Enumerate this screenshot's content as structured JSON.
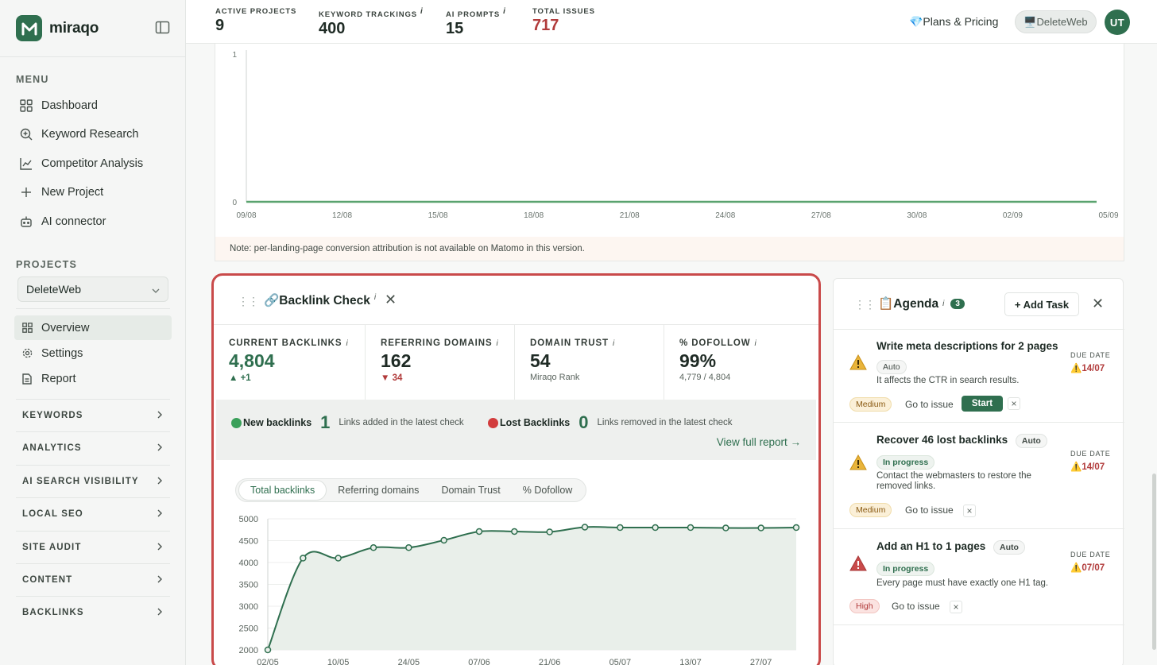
{
  "app": {
    "name": "miraqo"
  },
  "sidebar": {
    "menu_label": "MENU",
    "menu_items": [
      {
        "label": "Dashboard",
        "icon": "grid-icon"
      },
      {
        "label": "Keyword Research",
        "icon": "search-icon"
      },
      {
        "label": "Competitor Analysis",
        "icon": "chart-line-icon"
      },
      {
        "label": "New Project",
        "icon": "plus-icon"
      },
      {
        "label": "AI connector",
        "icon": "robot-icon"
      }
    ],
    "projects_label": "PROJECTS",
    "project_selected": "DeleteWeb",
    "project_items": [
      {
        "label": "Overview",
        "icon": "grid-icon",
        "active": true
      },
      {
        "label": "Settings",
        "icon": "gear-icon"
      },
      {
        "label": "Report",
        "icon": "document-icon"
      }
    ],
    "groups": [
      "KEYWORDS",
      "ANALYTICS",
      "AI SEARCH VISIBILITY",
      "LOCAL SEO",
      "SITE AUDIT",
      "CONTENT",
      "BACKLINKS"
    ]
  },
  "topbar": {
    "stats": [
      {
        "label": "ACTIVE PROJECTS",
        "value": "9",
        "info": ""
      },
      {
        "label": "KEYWORD TRACKINGS",
        "value": "400",
        "info": "i"
      },
      {
        "label": "AI PROMPTS",
        "value": "15",
        "info": "i"
      },
      {
        "label": "TOTAL ISSUES",
        "value": "717",
        "info": ""
      }
    ],
    "plans_label": "💎Plans & Pricing",
    "site_label": "🖥️DeleteWeb",
    "avatar_initials": "UT"
  },
  "conversion_chart": {
    "y_ticks": [
      "1",
      "0"
    ],
    "x_ticks": [
      "09/08",
      "12/08",
      "15/08",
      "18/08",
      "21/08",
      "24/08",
      "27/08",
      "30/08",
      "02/09",
      "05/09"
    ],
    "note": "Note: per-landing-page conversion attribution is not available on Matomo in this version."
  },
  "backlink_check": {
    "title": "🔗Backlink Check",
    "info": "i",
    "kpis": [
      {
        "label": "CURRENT BACKLINKS",
        "value": "4,804",
        "delta": "▲ +1",
        "delta_dir": "up",
        "sub": ""
      },
      {
        "label": "REFERRING DOMAINS",
        "value": "162",
        "delta": "▼ 34",
        "delta_dir": "down",
        "sub": ""
      },
      {
        "label": "DOMAIN TRUST",
        "value": "54",
        "delta": "",
        "sub": "Miraqo Rank"
      },
      {
        "label": "% DOFOLLOW",
        "value": "99%",
        "delta": "",
        "sub": "4,779 / 4,804"
      }
    ],
    "new_backlinks": {
      "label": "New backlinks",
      "count": "1",
      "desc": "Links added in the latest check",
      "color": "#3aa05a"
    },
    "lost_backlinks": {
      "label": "Lost Backlinks",
      "count": "0",
      "desc": "Links removed in the latest check",
      "color": "#d23c3c"
    },
    "view_full": "View full report →",
    "tabs": [
      {
        "label": "Total backlinks",
        "active": true
      },
      {
        "label": "Referring domains"
      },
      {
        "label": "Domain Trust"
      },
      {
        "label": "% Dofollow"
      }
    ]
  },
  "chart_data": {
    "type": "area",
    "title": "",
    "xlabel": "",
    "ylabel": "",
    "ylim": [
      2000,
      5000
    ],
    "y_ticks": [
      5000,
      4500,
      4000,
      3500,
      3000,
      2500,
      2000
    ],
    "x_tick_labels": [
      "02/05",
      "10/05",
      "24/05",
      "07/06",
      "21/06",
      "05/07",
      "13/07",
      "27/07"
    ],
    "series": [
      {
        "values": [
          2000,
          4100,
          4100,
          4340,
          4340,
          4510,
          4710,
          4710,
          4700,
          4810,
          4800,
          4800,
          4800,
          4790,
          4790,
          4800
        ]
      }
    ]
  },
  "agenda": {
    "title": "📋Agenda",
    "info": "i",
    "count": "3",
    "add_task": "+ Add Task",
    "due_label": "DUE DATE",
    "goto_label": "Go to issue",
    "start_label": "Start",
    "tasks": [
      {
        "title": "Write meta descriptions for 2 pages",
        "tag": "Auto",
        "desc": "It affects the CTR in search results.",
        "priority": "Medium",
        "due": "14/07"
      },
      {
        "title": "Recover 46 lost backlinks",
        "tag": "Auto",
        "status": "In progress",
        "desc": "Contact the webmasters to restore the removed links.",
        "priority": "Medium",
        "due": "14/07"
      },
      {
        "title": "Add an H1 to 1 pages",
        "tag": "Auto",
        "status": "In progress",
        "desc": "Every page must have exactly one H1 tag.",
        "priority": "High",
        "due": "07/07"
      }
    ]
  },
  "colors": {
    "brand": "#2f6f4f",
    "danger": "#b13b3b",
    "highlight_border": "#c94a4a"
  }
}
